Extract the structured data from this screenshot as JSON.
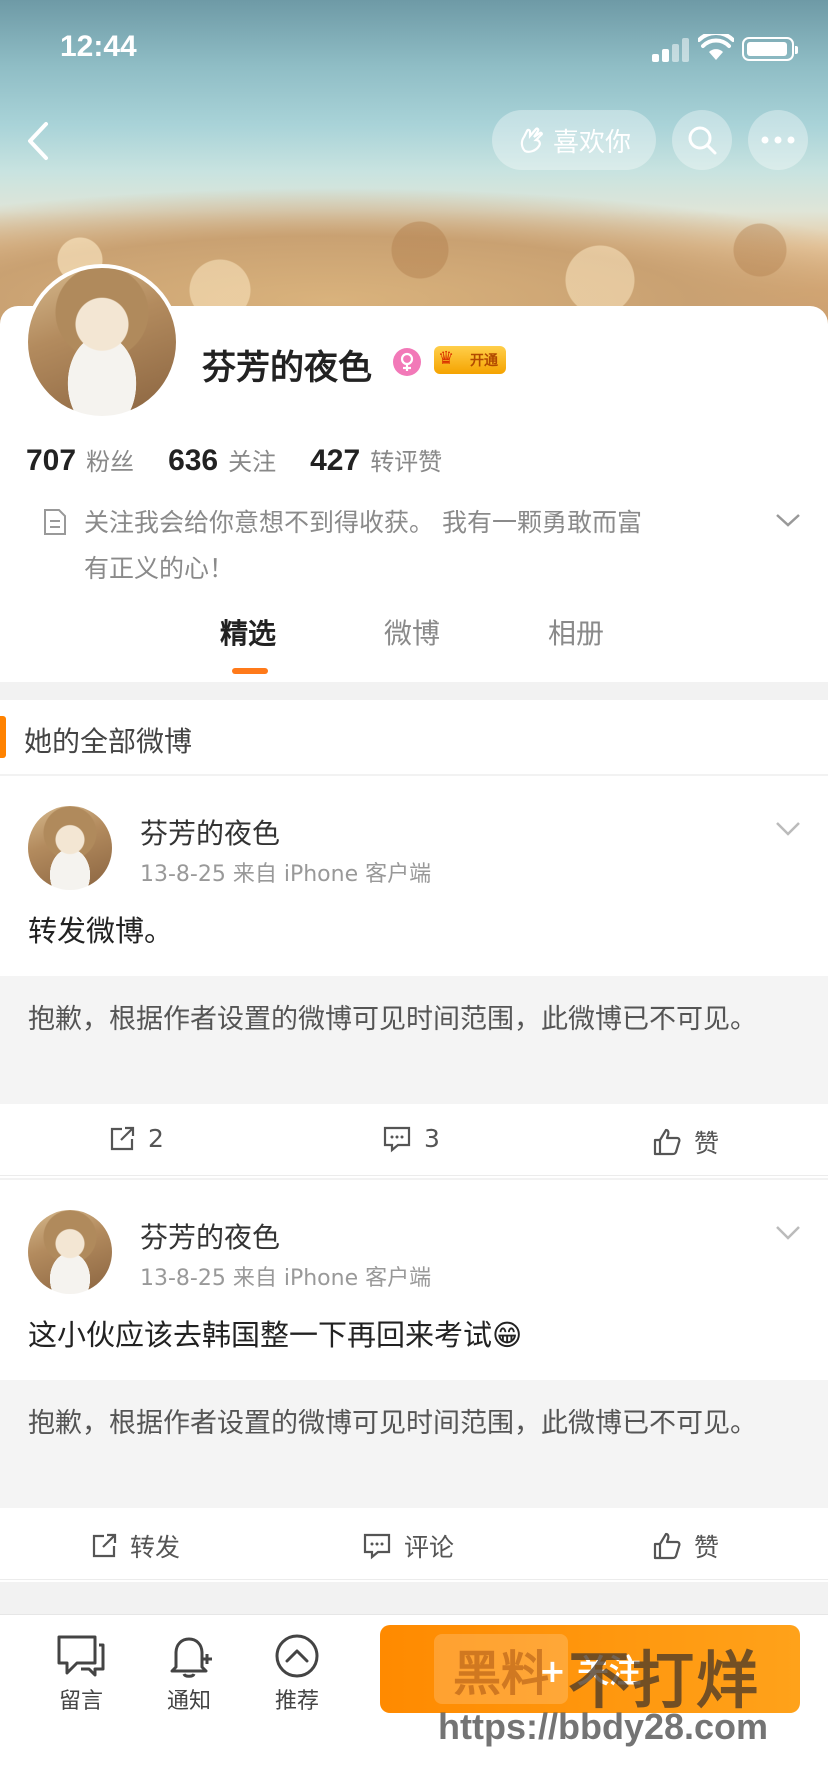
{
  "status": {
    "time": "12:44"
  },
  "header": {
    "like_label": "喜欢你"
  },
  "profile": {
    "name": "芬芳的夜色",
    "vip_label": "开通",
    "stats": [
      {
        "num": "707",
        "label": "粉丝"
      },
      {
        "num": "636",
        "label": "关注"
      },
      {
        "num": "427",
        "label": "转评赞"
      }
    ],
    "bio_line1": "关注我会给你意想不到得收获。 我有一颗勇敢而富",
    "bio_line2": "有正义的心！"
  },
  "tabs": [
    "精选",
    "微博",
    "相册"
  ],
  "active_tab": "精选",
  "section_title": "她的全部微博",
  "posts": [
    {
      "author": "芬芳的夜色",
      "meta": "13-8-25  来自 iPhone 客户端",
      "text": "转发微博。",
      "quote": "抱歉，根据作者设置的微博可见时间范围，此微博已不可见。",
      "repost": "2",
      "comment": "3",
      "like": "赞"
    },
    {
      "author": "芬芳的夜色",
      "meta": "13-8-25  来自 iPhone 客户端",
      "text": "这小伙应该去韩国整一下再回来考试😁",
      "quote": "抱歉，根据作者设置的微博可见时间范围，此微博已不可见。",
      "repost": "转发",
      "comment": "评论",
      "like": "赞"
    }
  ],
  "bottombar": {
    "message": "留言",
    "notify": "通知",
    "recommend": "推荐",
    "follow": "+ 关注"
  },
  "watermark": {
    "box": "黑料",
    "big": "不打烊",
    "url": "https://bbdy28.com"
  },
  "colors": {
    "accent": "#ff8200",
    "female": "#f279b8"
  }
}
